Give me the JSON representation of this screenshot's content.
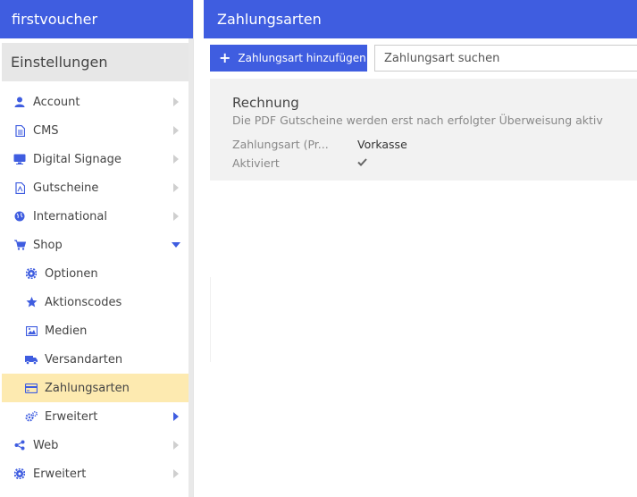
{
  "app": {
    "brand": "firstvoucher"
  },
  "sidebar": {
    "title": "Einstellungen",
    "items": [
      {
        "label": "Account",
        "icon": "user-icon"
      },
      {
        "label": "CMS",
        "icon": "document-icon"
      },
      {
        "label": "Digital Signage",
        "icon": "monitor-icon"
      },
      {
        "label": "Gutscheine",
        "icon": "pdf-file-icon"
      },
      {
        "label": "International",
        "icon": "globe-icon"
      },
      {
        "label": "Shop",
        "icon": "cart-icon",
        "expanded": true
      },
      {
        "label": "Optionen",
        "icon": "gear-icon"
      },
      {
        "label": "Aktionscodes",
        "icon": "star-icon"
      },
      {
        "label": "Medien",
        "icon": "image-icon"
      },
      {
        "label": "Versandarten",
        "icon": "truck-icon"
      },
      {
        "label": "Zahlungsarten",
        "icon": "credit-card-icon",
        "active": true
      },
      {
        "label": "Erweitert",
        "icon": "gears-icon"
      },
      {
        "label": "Web",
        "icon": "share-icon"
      },
      {
        "label": "Erweitert",
        "icon": "gear-icon"
      }
    ]
  },
  "main": {
    "title": "Zahlungsarten",
    "add_button": "Zahlungsart hinzufügen",
    "search_placeholder": "Zahlungsart suchen",
    "card": {
      "title": "Rechnung",
      "description": "Die PDF Gutscheine werden erst nach erfolgter Überweisung aktiv",
      "fields": [
        {
          "key": "Zahlungsart (Pr...",
          "value": "Vorkasse"
        },
        {
          "key": "Aktiviert",
          "value": "check-icon"
        }
      ]
    }
  },
  "colors": {
    "primary": "#3f5de0",
    "active_bg": "#fdeab0",
    "card_bg": "#f2f2f2"
  }
}
